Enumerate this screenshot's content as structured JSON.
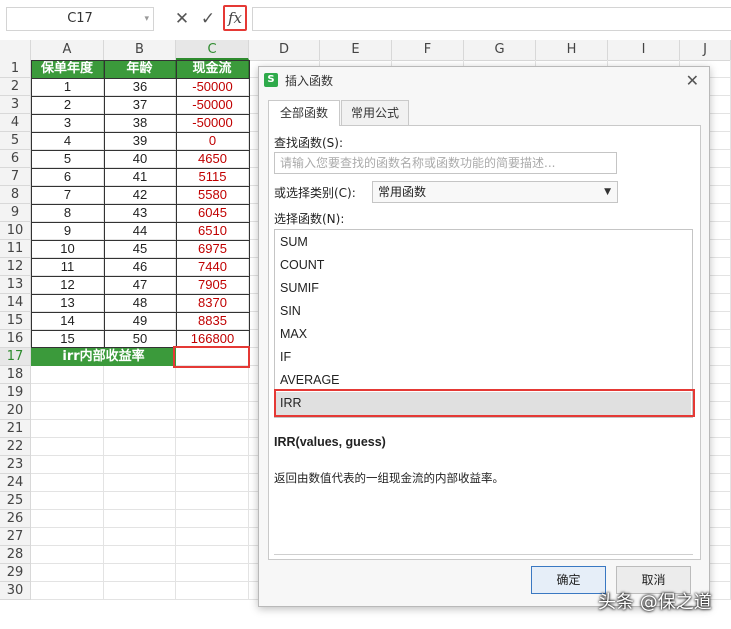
{
  "formula_bar": {
    "name_box": "C17",
    "cancel_icon": "close-icon",
    "confirm_icon": "check-icon",
    "fx_label": "fx"
  },
  "columns": [
    "A",
    "B",
    "C",
    "D",
    "E",
    "F",
    "G",
    "H",
    "I",
    "J"
  ],
  "rows": [
    "1",
    "2",
    "3",
    "4",
    "5",
    "6",
    "7",
    "8",
    "9",
    "10",
    "11",
    "12",
    "13",
    "14",
    "15",
    "16",
    "17",
    "18",
    "19",
    "20",
    "21",
    "22",
    "23",
    "24",
    "25",
    "26",
    "27",
    "28",
    "29",
    "30"
  ],
  "table": {
    "headers": [
      "保单年度",
      "年龄",
      "现金流"
    ],
    "data": [
      [
        "1",
        "36",
        "-50000"
      ],
      [
        "2",
        "37",
        "-50000"
      ],
      [
        "3",
        "38",
        "-50000"
      ],
      [
        "4",
        "39",
        "0"
      ],
      [
        "5",
        "40",
        "4650"
      ],
      [
        "6",
        "41",
        "5115"
      ],
      [
        "7",
        "42",
        "5580"
      ],
      [
        "8",
        "43",
        "6045"
      ],
      [
        "9",
        "44",
        "6510"
      ],
      [
        "10",
        "45",
        "6975"
      ],
      [
        "11",
        "46",
        "7440"
      ],
      [
        "12",
        "47",
        "7905"
      ],
      [
        "13",
        "48",
        "8370"
      ],
      [
        "14",
        "49",
        "8835"
      ],
      [
        "15",
        "50",
        "166800"
      ]
    ],
    "irr_label": "irr内部收益率"
  },
  "dialog": {
    "title": "插入函数",
    "close_icon": "close-icon",
    "tabs": [
      "全部函数",
      "常用公式"
    ],
    "search_label": "查找函数(S):",
    "search_placeholder": "请输入您要查找的函数名称或函数功能的简要描述...",
    "category_label": "或选择类别(C):",
    "category_value": "常用函数",
    "function_list_label": "选择函数(N):",
    "functions": [
      "SUM",
      "COUNT",
      "SUMIF",
      "SIN",
      "MAX",
      "IF",
      "AVERAGE",
      "IRR"
    ],
    "selected_function": "IRR",
    "signature": "IRR(values, guess)",
    "description": "返回由数值代表的一组现金流的内部收益率。",
    "ok_label": "确定",
    "cancel_label": "取消"
  },
  "watermark": "头条 @保之道",
  "colors": {
    "header_green": "#3b9a3b",
    "negative_red": "#c00000",
    "highlight_red": "#e53935"
  }
}
